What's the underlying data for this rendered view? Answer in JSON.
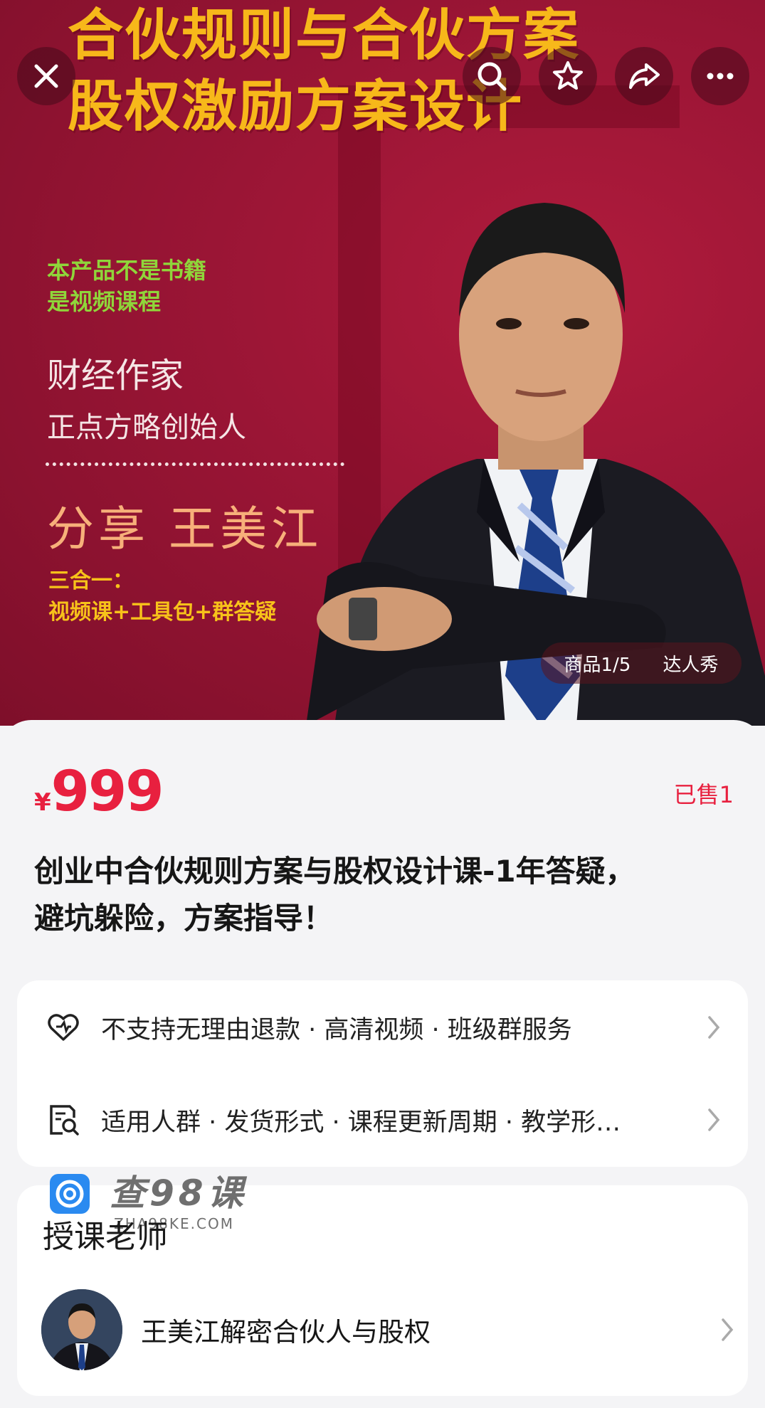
{
  "hero": {
    "title_line1": "合伙规则与合伙方案",
    "title_line2": "股权激励方案设计",
    "green_note_line1": "本产品不是书籍",
    "green_note_line2": "是视频课程",
    "author_title": "财经作家",
    "author_sub": "正点方略创始人",
    "share_line": "分享 王美江",
    "combo_line1": "三合一：",
    "combo_line2": "视频课+工具包+群答疑",
    "counter": "商品1/5",
    "showcase": "达人秀"
  },
  "top_buttons": {
    "close": "close-icon",
    "search": "search-icon",
    "favorite": "star-icon",
    "share": "share-icon",
    "more": "more-icon"
  },
  "product": {
    "currency": "¥",
    "price": "999",
    "sold": "已售1",
    "title_line1": "创业中合伙规则方案与股权设计课-1年答疑，",
    "title_line2": "避坑躲险，方案指导！"
  },
  "service_rows": [
    {
      "icon": "heart-shield-icon",
      "text": "不支持无理由退款 · 高清视频 · 班级群服务"
    },
    {
      "icon": "search-doc-icon",
      "text": "适用人群 · 发货形式 · 课程更新周期 · 教学形…"
    }
  ],
  "watermark": {
    "name": "查98课",
    "url": "ZHA98KE.COM"
  },
  "teacher": {
    "heading": "授课老师",
    "name": "王美江解密合伙人与股权"
  },
  "colors": {
    "accent": "#e8203f",
    "hero_bg": "#9a1535",
    "title_gold": "#f7b81a"
  }
}
